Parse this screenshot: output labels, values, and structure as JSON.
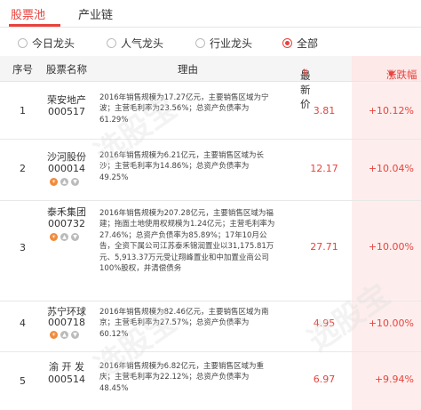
{
  "tabs": [
    "股票池",
    "产业链"
  ],
  "filters": [
    {
      "label": "今日龙头",
      "selected": false
    },
    {
      "label": "人气龙头",
      "selected": false
    },
    {
      "label": "行业龙头",
      "selected": false
    },
    {
      "label": "全部",
      "selected": true
    }
  ],
  "columns": {
    "idx": "序号",
    "name": "股票名称",
    "reason": "理由",
    "price": "最新价",
    "change": "涨跌幅"
  },
  "rows": [
    {
      "idx": "1",
      "name": "荣安地产",
      "code": "000517",
      "reason": "2016年销售规模为17.27亿元，主要销售区域为宁波；主营毛利率为23.56%；总资产负债率为61.29%",
      "price": "3.81",
      "change": "+10.12%",
      "badges": false
    },
    {
      "idx": "2",
      "name": "沙河股份",
      "code": "000014",
      "reason": "2016年销售规模为6.21亿元，主要销售区域为长沙；主营毛利率为14.86%；总资产负债率为49.25%",
      "price": "12.17",
      "change": "+10.04%",
      "badges": true
    },
    {
      "idx": "3",
      "name": "泰禾集团",
      "code": "000732",
      "reason": "2016年销售规模为207.28亿元，主要销售区域为福建；拖面土地使用权规模为1.24亿元；主营毛利率为27.46%；总资产负债率为85.89%；17年10月公告，全资下属公司江苏泰禾锦润置业以31,175.81万元、5,913.37万元受让翔峰置业和中加置业商公司100%股权，并清偿债务",
      "price": "27.71",
      "change": "+10.00%",
      "badges": true
    },
    {
      "idx": "4",
      "name": "苏宁环球",
      "code": "000718",
      "reason": "2016年销售规模为82.46亿元，主要销售区域为南京；主营毛利率为27.57%；总资产负债率为60.12%",
      "price": "4.95",
      "change": "+10.00%",
      "badges": true
    },
    {
      "idx": "5",
      "name": "渝 开 发",
      "code": "000514",
      "reason": "2016年销售规模为6.82亿元，主要销售区域为重庆；主营毛利率为22.12%；总资产负债率为48.45%",
      "price": "6.97",
      "change": "+9.94%",
      "badges": false
    }
  ],
  "colors": {
    "accent": "#e8433d"
  }
}
